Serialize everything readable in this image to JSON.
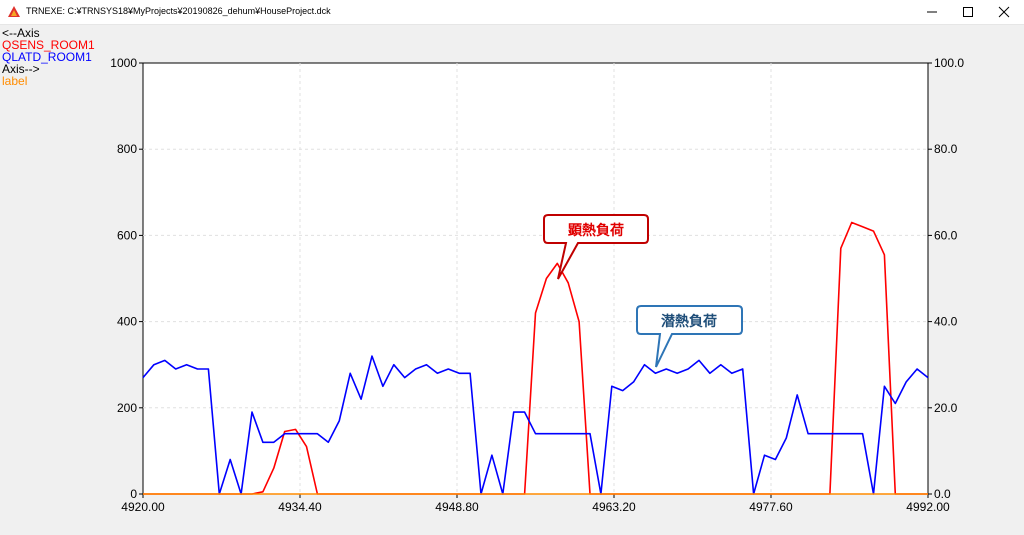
{
  "window": {
    "title": "TRNEXE: C:¥TRNSYS18¥MyProjects¥20190826_dehum¥HouseProject.dck",
    "buttons": [
      "minimize-icon",
      "maximize-icon",
      "close-icon"
    ]
  },
  "legend": {
    "left_axis": "<--Axis",
    "series1": "QSENS_ROOM1",
    "series2": "QLATD_ROOM1",
    "right_axis": "Axis-->",
    "series3": "label"
  },
  "colors": {
    "series1": "#ff0000",
    "series2": "#0000ff",
    "series3": "#ff8c00",
    "callout1_border": "#c00000",
    "callout1_text": "#e00000",
    "callout2_border": "#2e75b6",
    "callout2_text": "#1f4e79"
  },
  "callouts": {
    "sensible": "顕熱負荷",
    "latent": "潜熱負荷"
  },
  "chart_data": {
    "type": "line",
    "x_range": [
      4920.0,
      4992.0
    ],
    "left_ylim": [
      0,
      1000
    ],
    "right_ylim": [
      0.0,
      100.0
    ],
    "x_ticks": [
      "4920.00",
      "4934.40",
      "4948.80",
      "4963.20",
      "4977.60",
      "4992.00"
    ],
    "left_ticks": [
      "0",
      "200",
      "400",
      "600",
      "800",
      "1000"
    ],
    "right_ticks": [
      "0.0",
      "20.0",
      "40.0",
      "60.0",
      "80.0",
      "100.0"
    ],
    "grid": true,
    "series": [
      {
        "name": "QSENS_ROOM1",
        "axis": "left",
        "x": [
          4920,
          4929,
          4930,
          4931,
          4932,
          4933,
          4934,
          4935,
          4936,
          4937,
          4955,
          4956,
          4957,
          4958,
          4959,
          4960,
          4961,
          4962,
          4983,
          4984,
          4985,
          4986,
          4987,
          4988,
          4989,
          4990,
          4991,
          4992
        ],
        "y": [
          0,
          0,
          0,
          5,
          60,
          145,
          150,
          110,
          0,
          0,
          0,
          420,
          500,
          535,
          490,
          400,
          0,
          0,
          0,
          570,
          630,
          620,
          610,
          555,
          0,
          0,
          0,
          0
        ]
      },
      {
        "name": "QLATD_ROOM1",
        "axis": "right",
        "x": [
          4920,
          4921,
          4922,
          4923,
          4924,
          4925,
          4926,
          4927,
          4928,
          4929,
          4930,
          4931,
          4932,
          4933,
          4934,
          4935,
          4936,
          4937,
          4938,
          4939,
          4940,
          4941,
          4942,
          4943,
          4944,
          4945,
          4946,
          4947,
          4948,
          4949,
          4950,
          4951,
          4952,
          4953,
          4954,
          4955,
          4956,
          4957,
          4958,
          4959,
          4960,
          4961,
          4962,
          4963,
          4964,
          4965,
          4966,
          4967,
          4968,
          4969,
          4970,
          4971,
          4972,
          4973,
          4974,
          4975,
          4976,
          4977,
          4978,
          4979,
          4980,
          4981,
          4982,
          4983,
          4984,
          4985,
          4986,
          4987,
          4988,
          4989,
          4990,
          4991,
          4992
        ],
        "y": [
          27,
          30,
          31,
          29,
          30,
          29,
          29,
          0,
          8,
          0,
          19,
          12,
          12,
          14,
          14,
          14,
          14,
          12,
          17,
          28,
          22,
          32,
          25,
          30,
          27,
          29,
          30,
          28,
          29,
          28,
          28,
          0,
          9,
          0,
          19,
          19,
          14,
          14,
          14,
          14,
          14,
          14,
          0,
          25,
          24,
          26,
          30,
          28,
          29,
          28,
          29,
          31,
          28,
          30,
          28,
          29,
          0,
          9,
          8,
          13,
          23,
          14,
          14,
          14,
          14,
          14,
          14,
          0,
          25,
          21,
          26,
          29,
          27
        ]
      },
      {
        "name": "label",
        "axis": "right",
        "x": [
          4920,
          4992
        ],
        "y": [
          0,
          0
        ]
      }
    ]
  }
}
